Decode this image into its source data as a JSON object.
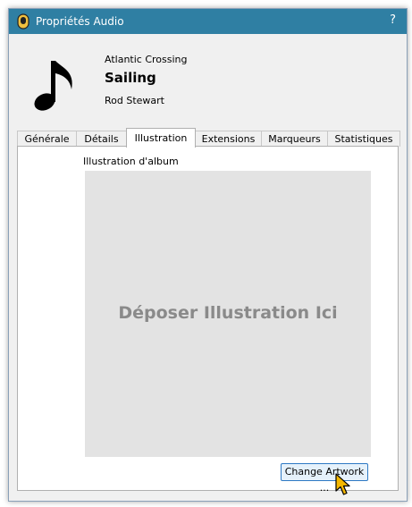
{
  "window": {
    "title": "Propriétés Audio",
    "help_label": "?"
  },
  "header": {
    "album": "Atlantic Crossing",
    "title": "Sailing",
    "artist": "Rod Stewart",
    "icon": "music-note-icon"
  },
  "tabs": [
    {
      "label": "Générale",
      "active": false
    },
    {
      "label": "Détails",
      "active": false
    },
    {
      "label": "Illustration",
      "active": true
    },
    {
      "label": "Extensions",
      "active": false
    },
    {
      "label": "Marqueurs",
      "active": false
    },
    {
      "label": "Statistiques",
      "active": false
    }
  ],
  "artwork": {
    "label": "Illustration d'album",
    "drop_text": "Déposer Illustration Ici",
    "change_button": "Change Artwork ..."
  },
  "colors": {
    "titlebar": "#2f7fa3",
    "dialog_bg": "#f0f0f0",
    "drop_zone": "#e3e3e3",
    "button_border": "#2e79c4",
    "cursor": "#f5b800"
  }
}
